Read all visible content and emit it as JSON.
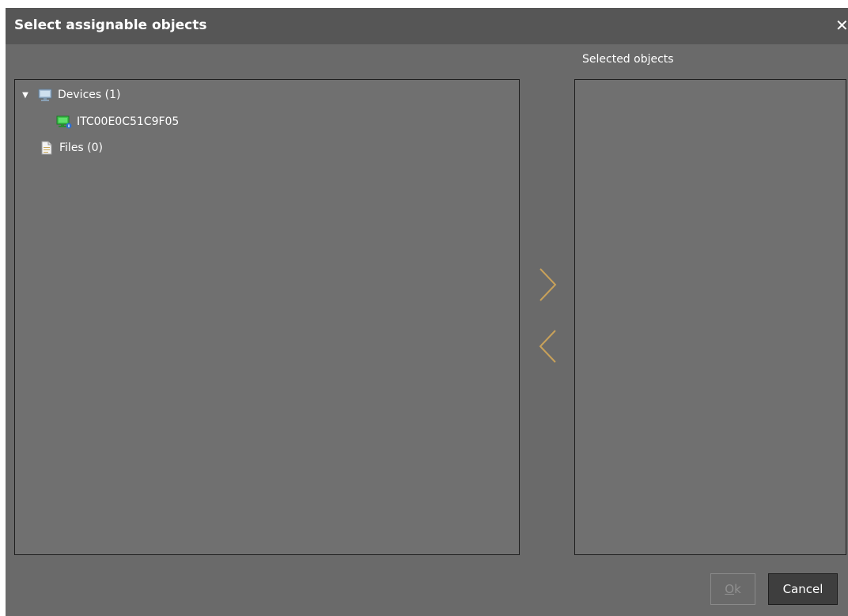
{
  "dialog": {
    "title": "Select assignable objects",
    "close_icon": "close-icon"
  },
  "tree": {
    "devices_label": "Devices (1)",
    "device_item": "ITC00E0C51C9F05",
    "files_label": "Files (0)",
    "icons": {
      "devices": "monitor-icon",
      "device": "green-monitor-icon",
      "files": "file-icon"
    }
  },
  "selected": {
    "heading": "Selected objects"
  },
  "transfer": {
    "add_icon": "chevron-right-icon",
    "remove_icon": "chevron-left-icon",
    "color": "#c8a15a"
  },
  "buttons": {
    "ok_mnemonic": "O",
    "ok_rest": "k",
    "cancel": "Cancel"
  }
}
